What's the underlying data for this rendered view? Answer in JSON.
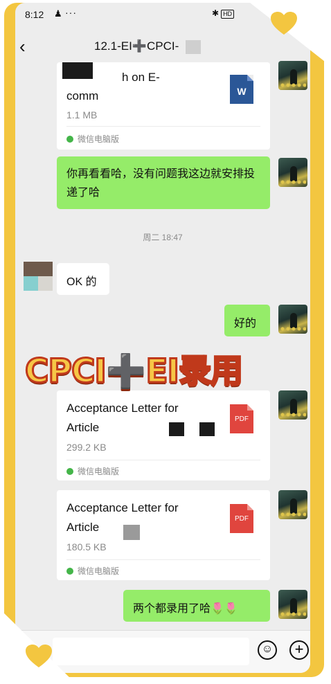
{
  "statusbar": {
    "time": "8:12",
    "right_icons": "✱",
    "hd": "HD"
  },
  "navbar": {
    "title": "12.1-EI➕CPCI-"
  },
  "messages": {
    "card1": {
      "filename_line1": "h on E-",
      "filename_line2": "comm",
      "filesize": "1.1 MB",
      "source": "微信电脑版",
      "icon_label": "W"
    },
    "msg_green1": "你再看看哈，没有问题我这边就安排投递了哈",
    "timestamp": "周二 18:47",
    "msg_white1": "OK 的",
    "msg_green2": "好的",
    "card2": {
      "filename_line1": "Acceptance Letter for",
      "filename_line2": "Article",
      "filesize": "299.2 KB",
      "source": "微信电脑版",
      "icon_label": "PDF"
    },
    "card3": {
      "filename_line1": "Acceptance Letter for",
      "filename_line2": "Article",
      "filesize": "180.5 KB",
      "source": "微信电脑版",
      "icon_label": "PDF"
    },
    "msg_green3": "两个都录用了哈🌷🌷"
  },
  "overlay": {
    "text": "CPCI➕EI录用"
  },
  "inputbar": {
    "emoji": "☺",
    "plus": "+"
  },
  "colors": {
    "accent_yellow": "#f3c640",
    "bubble_green": "#95ec69",
    "chat_bg": "#ededed",
    "overlay_stroke": "#c0391b"
  }
}
